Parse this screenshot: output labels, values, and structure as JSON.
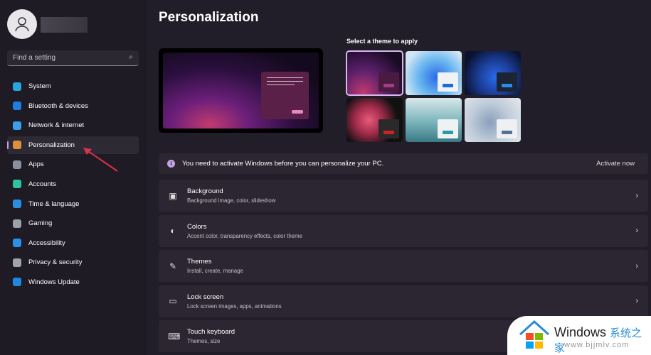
{
  "sidebar": {
    "search_placeholder": "Find a setting",
    "items": [
      {
        "label": "System",
        "color": "#2aa5e0"
      },
      {
        "label": "Bluetooth & devices",
        "color": "#1f7fe0"
      },
      {
        "label": "Network & internet",
        "color": "#3aa0e8"
      },
      {
        "label": "Personalization",
        "color": "#e0903a",
        "selected": true
      },
      {
        "label": "Apps",
        "color": "#8a8fa0"
      },
      {
        "label": "Accounts",
        "color": "#2ec4a0"
      },
      {
        "label": "Time & language",
        "color": "#2a8ee0"
      },
      {
        "label": "Gaming",
        "color": "#9aa0ac"
      },
      {
        "label": "Accessibility",
        "color": "#2a90e8"
      },
      {
        "label": "Privacy & security",
        "color": "#a0a4ac"
      },
      {
        "label": "Windows Update",
        "color": "#1e88e0"
      }
    ]
  },
  "main": {
    "title": "Personalization",
    "themes_label": "Select a theme to apply",
    "banner": {
      "text": "You need to activate Windows before you can personalize your PC.",
      "action": "Activate now"
    },
    "cards": [
      {
        "title": "Background",
        "subtitle": "Background image, color, slideshow",
        "icon": "image-icon"
      },
      {
        "title": "Colors",
        "subtitle": "Accent color, transparency effects, color theme",
        "icon": "palette-icon"
      },
      {
        "title": "Themes",
        "subtitle": "Install, create, manage",
        "icon": "brush-icon"
      },
      {
        "title": "Lock screen",
        "subtitle": "Lock screen images, apps, animations",
        "icon": "lock-screen-icon"
      },
      {
        "title": "Touch keyboard",
        "subtitle": "Themes, size",
        "icon": "keyboard-icon"
      }
    ]
  },
  "watermark": {
    "brand": "Windows",
    "cn": "系统之家",
    "url": "www.bjjmlv.com"
  }
}
